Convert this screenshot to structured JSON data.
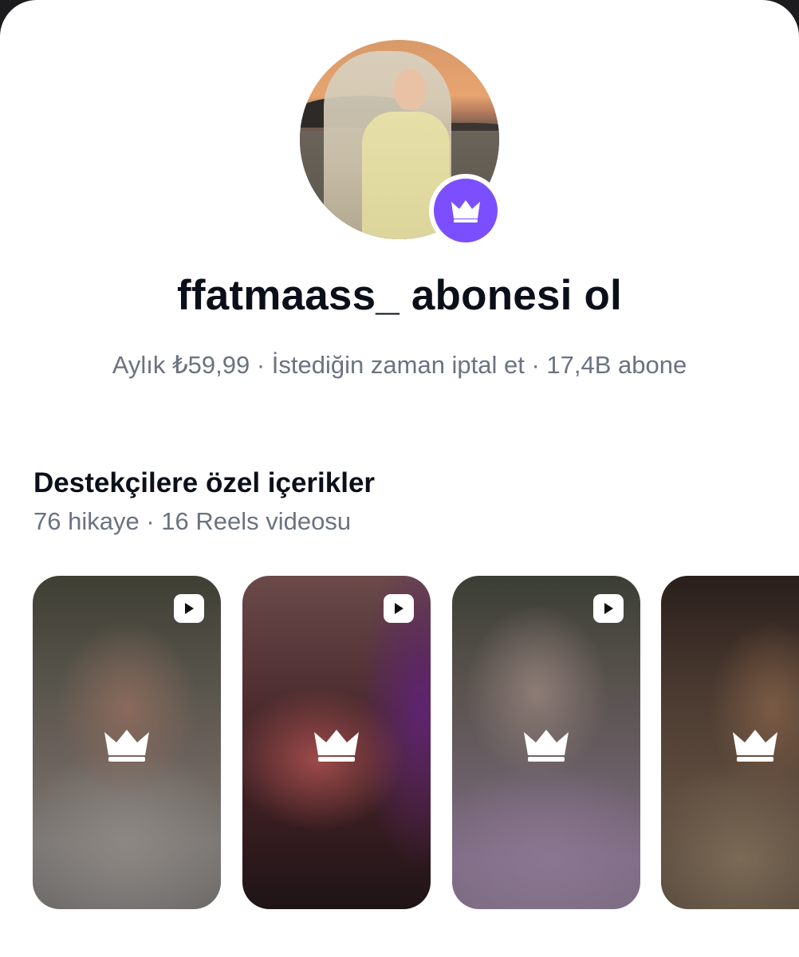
{
  "profile": {
    "title": "ffatmaass_ abonesi ol",
    "subtitle": "Aylık ₺59,99 · İstediğin zaman iptal et · 17,4B abone",
    "badge_icon": "crown-icon",
    "badge_color": "#7b4fff"
  },
  "section": {
    "title": "Destekçilere özel içerikler",
    "subtitle": "76 hikaye · 16 Reels videosu"
  },
  "cards": [
    {
      "type": "reel",
      "icon": "play-icon",
      "lock_icon": "crown-icon"
    },
    {
      "type": "reel",
      "icon": "play-icon",
      "lock_icon": "crown-icon"
    },
    {
      "type": "reel",
      "icon": "play-icon",
      "lock_icon": "crown-icon"
    },
    {
      "type": "story",
      "lock_icon": "crown-icon"
    }
  ]
}
